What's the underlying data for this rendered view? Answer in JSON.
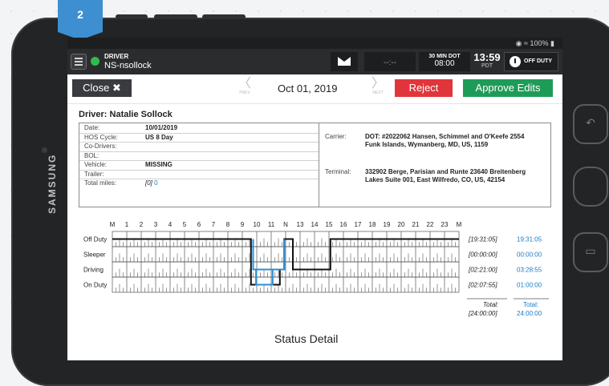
{
  "step_badge": "2",
  "device_brand": "SAMSUNG",
  "status_bar": {
    "text": "100%"
  },
  "appbar": {
    "role": "DRIVER",
    "driver_id": "NS-nsollock",
    "time_field": "--:--",
    "dot_label": "30 MIN DOT",
    "dot_value": "08:00",
    "clock_time": "13:59",
    "clock_zone": "PDT",
    "duty_status": "OFF DUTY"
  },
  "toolbar": {
    "close_label": "Close",
    "prev_label": "PREV",
    "next_label": "NEXT",
    "date": "Oct 01, 2019",
    "reject_label": "Reject",
    "approve_label": "Approve Edits"
  },
  "driver_heading": "Driver: Natalie Sollock",
  "info_left": [
    {
      "key": "Date:",
      "value": "10/01/2019"
    },
    {
      "key": "HOS Cycle:",
      "value": "US 8 Day"
    },
    {
      "key": "Co-Drivers:",
      "value": ""
    },
    {
      "key": "BOL:",
      "value": ""
    },
    {
      "key": "Vehicle:",
      "value": "MISSING"
    },
    {
      "key": "Trailer:",
      "value": ""
    },
    {
      "key": "Total miles:",
      "value_prefix": "[0]",
      "value": "0"
    }
  ],
  "carrier": {
    "label": "Carrier:",
    "value": "DOT: #2022062 Hansen, Schimmel and O'Keefe 2554 Funk Islands, Wymanberg, MD, US, 1159"
  },
  "terminal": {
    "label": "Terminal:",
    "value": "332902 Berge, Parisian and Runte 23640 Breitenberg Lakes Suite 001, East Wilfredo, CO, US, 42154"
  },
  "chart_data": {
    "type": "line",
    "hour_labels": [
      "M",
      "1",
      "2",
      "3",
      "4",
      "5",
      "6",
      "7",
      "8",
      "9",
      "10",
      "11",
      "N",
      "13",
      "14",
      "15",
      "16",
      "17",
      "18",
      "19",
      "20",
      "21",
      "22",
      "23",
      "M"
    ],
    "rows": [
      "Off Duty",
      "Sleeper",
      "Driving",
      "On Duty"
    ],
    "series": [
      {
        "color": "#111111",
        "points": [
          [
            0,
            "Off Duty"
          ],
          [
            9.6,
            "Off Duty"
          ],
          [
            9.6,
            "On Duty"
          ],
          [
            11.6,
            "On Duty"
          ],
          [
            11.6,
            "Driving"
          ],
          [
            11.9,
            "Driving"
          ],
          [
            11.9,
            "Off Duty"
          ],
          [
            12.5,
            "Off Duty"
          ],
          [
            12.5,
            "Driving"
          ],
          [
            15.1,
            "Driving"
          ],
          [
            15.1,
            "Off Duty"
          ],
          [
            24,
            "Off Duty"
          ]
        ]
      },
      {
        "color": "#2a8fd6",
        "points": [
          [
            9.75,
            "Off Duty"
          ],
          [
            9.75,
            "Driving"
          ],
          [
            11.1,
            "Driving"
          ],
          [
            11.1,
            "On Duty"
          ],
          [
            9.95,
            "On Duty"
          ],
          [
            9.95,
            "Driving"
          ],
          [
            11.9,
            "Driving"
          ],
          [
            11.9,
            "Off Duty"
          ]
        ]
      }
    ],
    "totals_bracketed": [
      "[19:31:05]",
      "[00:00:00]",
      "[02:21:00]",
      "[02:07:55]"
    ],
    "totals": [
      "19:31:05",
      "00:00:00",
      "03:28:55",
      "01:00:00"
    ],
    "total_label": "Total:",
    "total_bracketed": "[24:00:00]",
    "total_value": "24:00:00"
  },
  "status_detail_title": "Status Detail"
}
